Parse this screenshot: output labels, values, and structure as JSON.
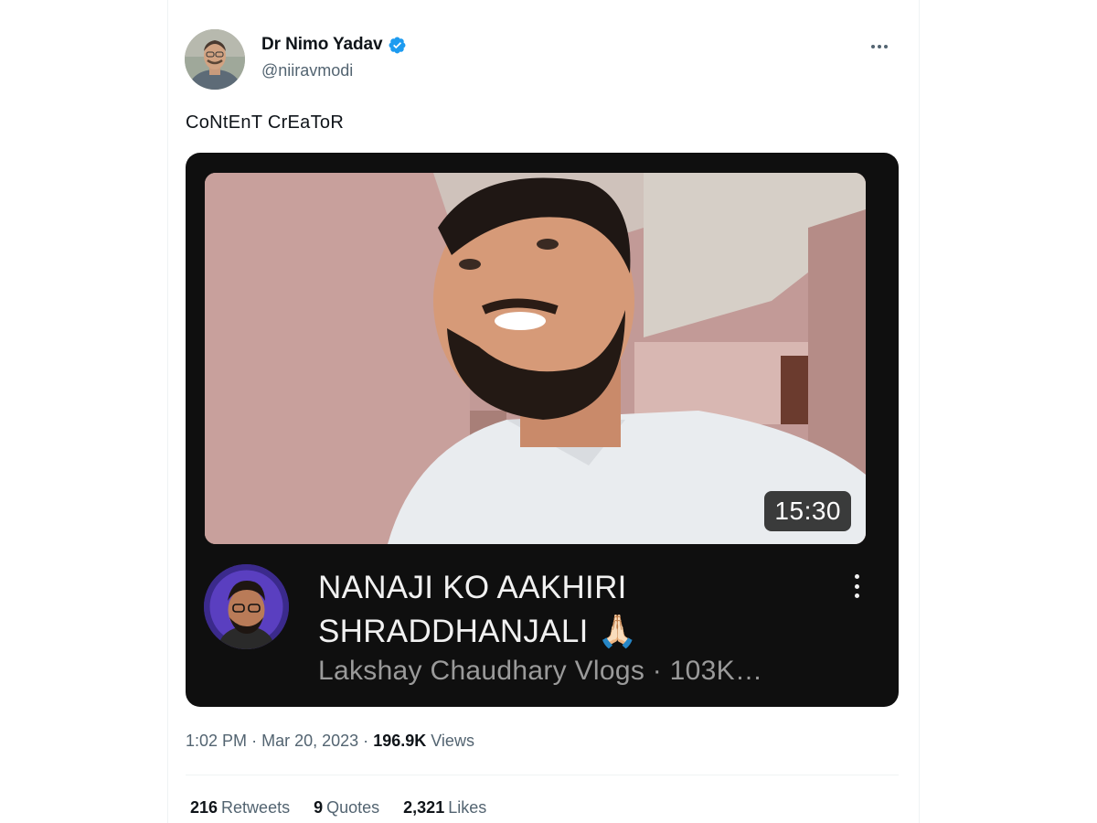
{
  "author": {
    "display_name": "Dr Nimo Yadav",
    "handle": "@niiravmodi",
    "verified": true,
    "verified_color": "#1d9bf0"
  },
  "tweet": {
    "text": "CoNtEnT CrEaToR"
  },
  "video_card": {
    "duration": "15:30",
    "title_line1": "NANAJI KO AAKHIRI",
    "title_line2": "SHRADDHANJALI 🙏🏻",
    "channel_line": "Lakshay Chaudhary Vlogs · 103K…",
    "background": "#0f0f0f"
  },
  "meta": {
    "time": "1:02 PM",
    "separator": "·",
    "date": "Mar 20, 2023",
    "views_count": "196.9K",
    "views_label": "Views"
  },
  "stats": {
    "retweets_count": "216",
    "retweets_label": "Retweets",
    "quotes_count": "9",
    "quotes_label": "Quotes",
    "likes_count": "2,321",
    "likes_label": "Likes"
  },
  "icons": {
    "more": "more-horizontal-icon",
    "video_menu": "more-vertical-icon",
    "verified": "verified-badge-icon"
  }
}
